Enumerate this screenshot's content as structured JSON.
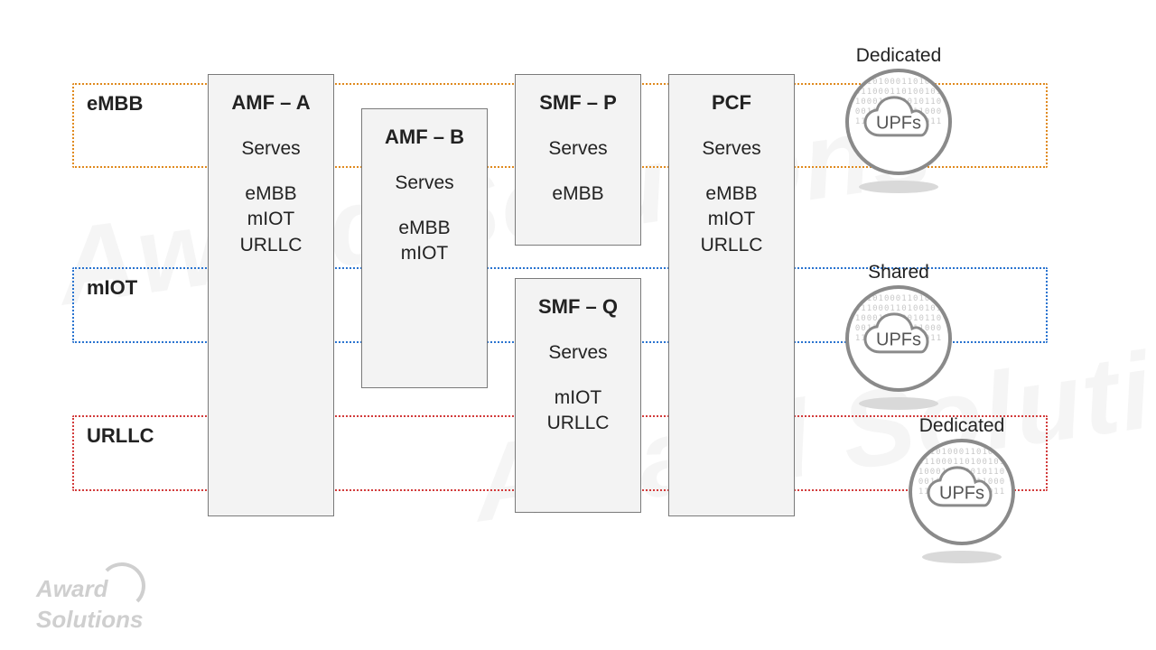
{
  "labels": {
    "serves": "Serves"
  },
  "slices": [
    {
      "name": "eMBB",
      "color": "#e08a1e"
    },
    {
      "name": "mIOT",
      "color": "#2a74d0"
    },
    {
      "name": "URLLC",
      "color": "#d23b3b"
    }
  ],
  "nfs": [
    {
      "id": "amf-a",
      "title": "AMF – A",
      "serves": [
        "eMBB",
        "mIOT",
        "URLLC"
      ]
    },
    {
      "id": "amf-b",
      "title": "AMF – B",
      "serves": [
        "eMBB",
        "mIOT"
      ]
    },
    {
      "id": "smf-p",
      "title": "SMF – P",
      "serves": [
        "eMBB"
      ]
    },
    {
      "id": "smf-q",
      "title": "SMF – Q",
      "serves": [
        "mIOT",
        "URLLC"
      ]
    },
    {
      "id": "pcf",
      "title": "PCF",
      "serves": [
        "eMBB",
        "mIOT",
        "URLLC"
      ]
    }
  ],
  "upfs": [
    {
      "label": "UPFs",
      "mode": "Dedicated",
      "slice": "eMBB"
    },
    {
      "label": "UPFs",
      "mode": "Shared",
      "slice": "mIOT"
    },
    {
      "label": "UPFs",
      "mode": "Dedicated",
      "slice": "URLLC"
    }
  ],
  "brand": "Award Solutions"
}
